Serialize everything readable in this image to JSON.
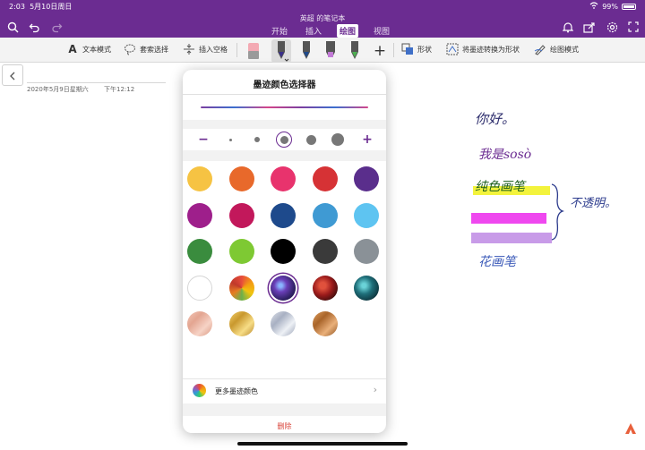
{
  "status": {
    "time": "2:03",
    "date": "5月10日周日",
    "battery": "99%"
  },
  "header": {
    "notebook_title": "英超 的笔记本",
    "tabs": [
      {
        "label": "开始"
      },
      {
        "label": "插入"
      },
      {
        "label": "绘图",
        "active": true
      },
      {
        "label": "视图"
      }
    ]
  },
  "ribbon": {
    "text_mode": "文本模式",
    "lasso_select": "套索选择",
    "insert_space": "插入空格",
    "shapes": "形状",
    "ink_to_shape": "将墨迹转换为形状",
    "draw_mode": "绘图模式"
  },
  "page": {
    "date": "2020年5月9日星期六",
    "time": "下午12:12"
  },
  "ink_picker": {
    "title": "墨迹颜色选择器",
    "minus": "−",
    "plus": "+",
    "colors": [
      "#f6c343",
      "#e8692b",
      "#e8336d",
      "#d63235",
      "#5a2e8c",
      "#9e1f8b",
      "#c2185b",
      "#1e4a8c",
      "#3f9ad3",
      "#5ec4f1",
      "#3a8c3e",
      "#7ec933",
      "#000000",
      "#3a3a3a",
      "#8a9197",
      "#ffffff",
      "texture-rainbow",
      "texture-galaxy",
      "texture-lava",
      "texture-ocean",
      "texture-rosegold",
      "texture-gold",
      "texture-silver",
      "texture-bronze"
    ],
    "selected_color_index": 17,
    "more_colors": "更多墨迹颜色",
    "delete": "删除"
  },
  "ink_notes": {
    "line1": "你好。",
    "line2": "我是sosò",
    "line3": "纯色画笔",
    "line4": "不透明。",
    "line5": "花画笔"
  }
}
